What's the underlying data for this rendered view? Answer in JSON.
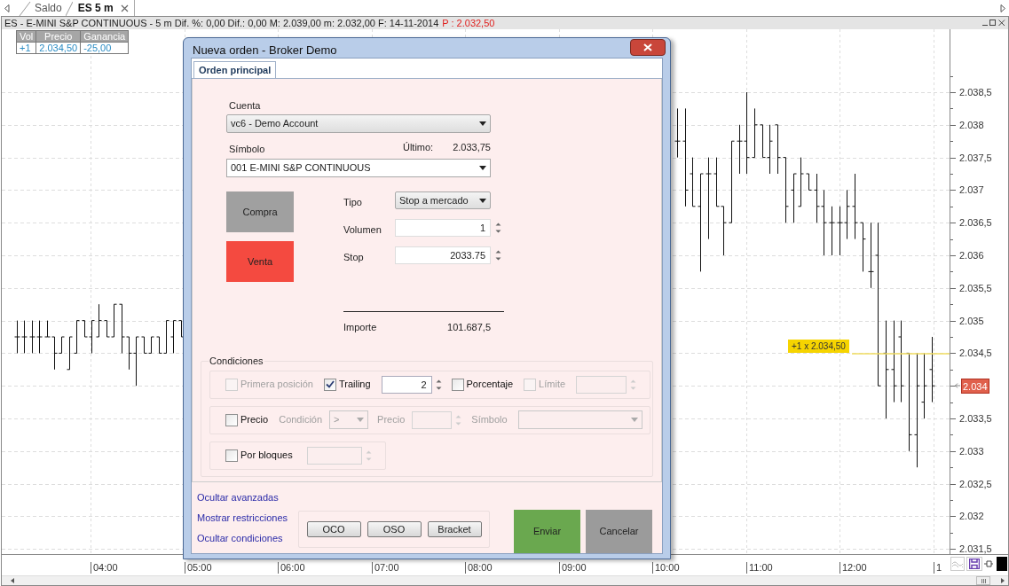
{
  "tabs": [
    {
      "label": "Saldo",
      "selected": false
    },
    {
      "label": "ES 5 m",
      "selected": true
    }
  ],
  "chart": {
    "header": "ES - E-MINI S&P CONTINUOUS -  5 m  Dif. %: 0,00  Dif.: 0,00  M: 2.039,00  m: 2.032,00  F: 14-11-2014",
    "last_price": "P : 2.032,50",
    "positions": {
      "columns": [
        "Vol",
        "Precio",
        "Ganancia"
      ],
      "row": [
        "+1",
        "2.034,50",
        "-25,00"
      ]
    },
    "price_labels": [
      {
        "label": "2.038,5",
        "current": false
      },
      {
        "label": "2.038",
        "current": false
      },
      {
        "label": "2.037,5",
        "current": false
      },
      {
        "label": "2.037",
        "current": false
      },
      {
        "label": "2.036,5",
        "current": false
      },
      {
        "label": "2.036",
        "current": false
      },
      {
        "label": "2.035,5",
        "current": false
      },
      {
        "label": "2.035",
        "current": false
      },
      {
        "label": "2.034,5",
        "current": false
      },
      {
        "label": "2.034",
        "current": true
      },
      {
        "label": "2.033,5",
        "current": false
      },
      {
        "label": "2.033",
        "current": false
      },
      {
        "label": "2.032,5",
        "current": false
      },
      {
        "label": "2.032",
        "current": false
      },
      {
        "label": "2.031,5",
        "current": false
      }
    ],
    "position_marker": "+1 x 2.034,50",
    "time_labels": [
      "04:00",
      "05:00",
      "06:00",
      "07:00",
      "08:00",
      "09:00",
      "10:00",
      "11:00",
      "12:00",
      "1"
    ]
  },
  "dialog": {
    "title": "Nueva orden - Broker Demo",
    "tab": "Orden principal",
    "account_label": "Cuenta",
    "account": "vc6  -  Demo Account",
    "symbol_label": "Símbolo",
    "last_label": "Último:",
    "last_value": "2.033,75",
    "symbol": "001 E-MINI S&P CONTINUOUS",
    "side_buttons": [
      {
        "label": "Compra",
        "selected": false
      },
      {
        "label": "Venta",
        "selected": true
      }
    ],
    "fields": [
      {
        "kind": "select",
        "label": "Tipo",
        "value": "Stop a mercado"
      },
      {
        "kind": "spin",
        "label": "Volumen",
        "value": "1"
      },
      {
        "kind": "spin",
        "label": "Stop",
        "value": "2033.75"
      }
    ],
    "total_label": "Importe",
    "total_value": "101.687,5",
    "conditions": {
      "title": "Condiciones",
      "groups": [
        {
          "items": [
            {
              "kind": "checkbox",
              "label": "Primera posición",
              "checked": false,
              "disabled": true
            },
            {
              "kind": "checkbox",
              "label": "Trailing",
              "checked": true,
              "disabled": false
            },
            {
              "kind": "spin",
              "value": "2",
              "disabled": false
            },
            {
              "kind": "checkbox",
              "label": "Porcentaje",
              "checked": false,
              "disabled": false
            },
            {
              "kind": "checkbox",
              "label": "Límite",
              "checked": false,
              "disabled": true
            },
            {
              "kind": "spin",
              "disabled": true
            }
          ]
        },
        {
          "items": [
            {
              "kind": "checkbox",
              "label": "Precio",
              "checked": false,
              "disabled": false
            },
            {
              "kind": "label",
              "label": "Condición",
              "disabled": true
            },
            {
              "kind": "select",
              "value": ">",
              "disabled": true
            },
            {
              "kind": "label",
              "label": "Precio",
              "disabled": true
            },
            {
              "kind": "spin",
              "disabled": true
            },
            {
              "kind": "label",
              "label": "Símbolo",
              "disabled": true
            },
            {
              "kind": "wideselect",
              "disabled": true
            }
          ]
        },
        {
          "items": [
            {
              "kind": "checkbox",
              "label": "Por bloques",
              "checked": false,
              "disabled": false
            },
            {
              "kind": "spin",
              "disabled": true
            }
          ]
        }
      ]
    },
    "links": [
      "Ocultar avanzadas",
      "Mostrar restricciones",
      "Ocultar condiciones"
    ],
    "order_types": [
      "OCO",
      "OSO",
      "Bracket"
    ],
    "submit": "Enviar",
    "cancel": "Cancelar"
  }
}
